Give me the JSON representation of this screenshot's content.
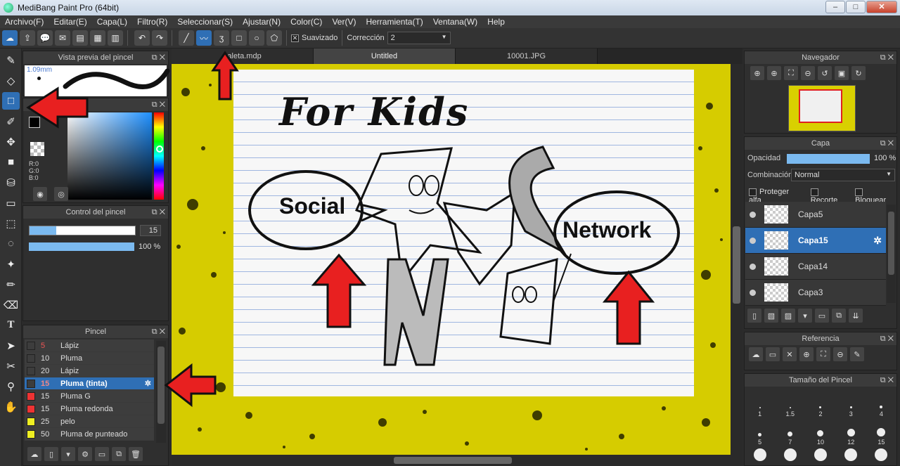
{
  "window": {
    "title": "MediBang Paint Pro (64bit)",
    "min": "–",
    "max": "□",
    "close": "✕"
  },
  "menu": [
    "Archivo(F)",
    "Editar(E)",
    "Capa(L)",
    "Filtro(R)",
    "Seleccionar(S)",
    "Ajustar(N)",
    "Color(C)",
    "Ver(V)",
    "Herramienta(T)",
    "Ventana(W)",
    "Help"
  ],
  "toolbar": {
    "smooth_label": "Suavizado",
    "correction_label": "Corrección",
    "correction_value": "2"
  },
  "tabs": [
    "paleta.mdp",
    "Untitled",
    "10001.JPG"
  ],
  "brush_preview": {
    "title": "Vista previa del pincel",
    "size": "1.09mm"
  },
  "color_panel": {
    "r": "R:0",
    "g": "G:0",
    "b": "B:0"
  },
  "brush_control": {
    "title": "Control del pincel",
    "size": "15",
    "opacity": "100 %",
    "size_fraction": 0.25,
    "opacity_fraction": 1.0
  },
  "brush_list": {
    "title": "Pincel",
    "items": [
      {
        "size": "5",
        "name": "Lápiz",
        "color": "#3d3d3d",
        "size_color": "#e55"
      },
      {
        "size": "10",
        "name": "Pluma",
        "color": "#3d3d3d",
        "size_color": "#ddd"
      },
      {
        "size": "20",
        "name": "Lápiz",
        "color": "#3d3d3d",
        "size_color": "#ddd"
      },
      {
        "size": "15",
        "name": "Pluma (tinta)",
        "color": "#3d3d3d",
        "size_color": "#e55"
      },
      {
        "size": "15",
        "name": "Pluma G",
        "color": "#e33",
        "size_color": "#ddd"
      },
      {
        "size": "15",
        "name": "Pluma redonda",
        "color": "#e33",
        "size_color": "#ddd"
      },
      {
        "size": "25",
        "name": "pelo",
        "color": "#ee2",
        "size_color": "#ddd"
      },
      {
        "size": "50",
        "name": "Pluma de punteado",
        "color": "#ee2",
        "size_color": "#ddd"
      }
    ]
  },
  "canvas": {
    "title_text": "For Kids",
    "bubble_left": "Social",
    "bubble_right": "Network"
  },
  "navigator": {
    "title": "Navegador"
  },
  "layers": {
    "title": "Capa",
    "opacity_label": "Opacidad",
    "opacity_value": "100 %",
    "blend_label": "Combinación",
    "blend_value": "Normal",
    "protect_alpha": "Proteger alfa",
    "clip": "Recorte",
    "lock": "Bloquear",
    "items": [
      "Capa5",
      "Capa15",
      "Capa14",
      "Capa3"
    ]
  },
  "reference": {
    "title": "Referencia"
  },
  "brush_size": {
    "title": "Tamaño del Pincel",
    "sizes": [
      "1",
      "1.5",
      "2",
      "3",
      "4",
      "5",
      "7",
      "10",
      "12",
      "15"
    ]
  }
}
